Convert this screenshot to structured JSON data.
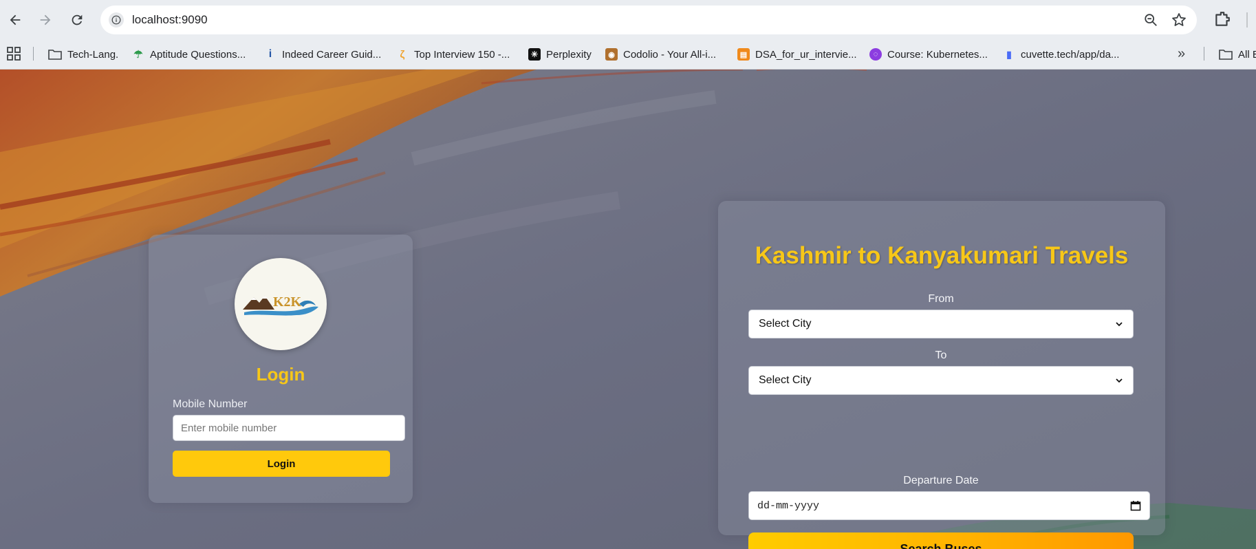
{
  "browser": {
    "url": "localhost:9090",
    "bookmarks": [
      {
        "label": "Tech-Lang.",
        "icon": "folder-icon"
      },
      {
        "label": "Aptitude Questions...",
        "icon": "umbrella-icon"
      },
      {
        "label": "Indeed Career Guid...",
        "icon": "indeed-icon"
      },
      {
        "label": "Top Interview 150 -...",
        "icon": "leetcode-icon"
      },
      {
        "label": "Perplexity",
        "icon": "perplexity-icon"
      },
      {
        "label": "Codolio - Your All-i...",
        "icon": "owl-icon"
      },
      {
        "label": "DSA_for_ur_intervie...",
        "icon": "book-icon"
      },
      {
        "label": "Course: Kubernetes...",
        "icon": "course-icon"
      },
      {
        "label": "cuvette.tech/app/da...",
        "icon": "cuvette-icon"
      }
    ],
    "all_bookmarks_label": "All B"
  },
  "login": {
    "logo_text": "K2K",
    "title": "Login",
    "mobile_label": "Mobile Number",
    "mobile_placeholder": "Enter mobile number",
    "button_label": "Login"
  },
  "search": {
    "title": "Kashmir to Kanyakumari Travels",
    "from_label": "From",
    "from_value": "Select City",
    "to_label": "To",
    "to_value": "Select City",
    "date_label": "Departure Date",
    "date_placeholder": "dd-mm-yyyy",
    "button_label": "Search Buses"
  },
  "colors": {
    "accent": "#f7c718",
    "button": "#ffc90c",
    "background": "#6b6e82"
  }
}
